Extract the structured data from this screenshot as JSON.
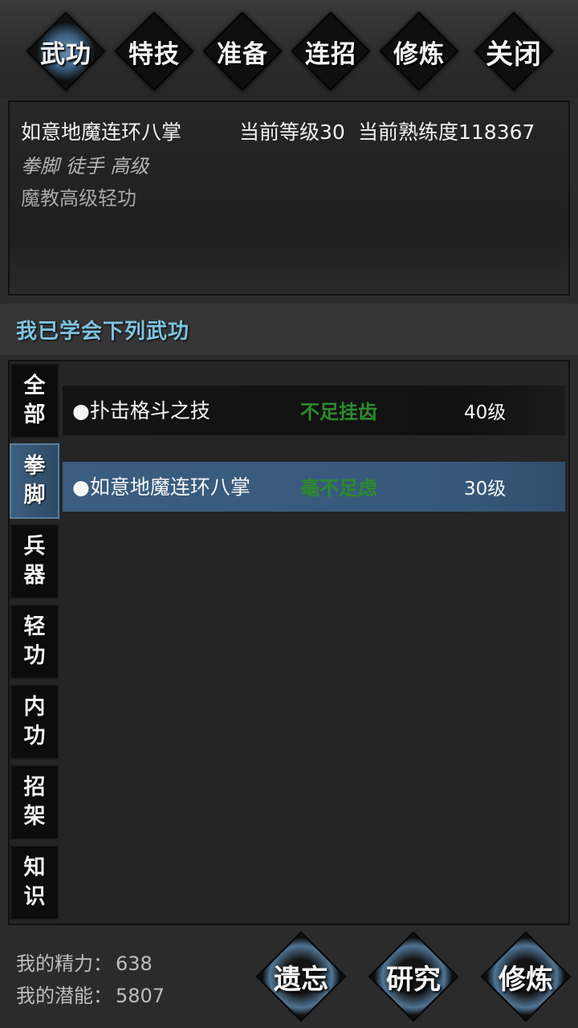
{
  "tabs": [
    {
      "label": "武功"
    },
    {
      "label": "特技"
    },
    {
      "label": "准备"
    },
    {
      "label": "连招"
    },
    {
      "label": "修炼"
    },
    {
      "label": "关闭"
    }
  ],
  "info": {
    "name": "如意地魔连环八掌",
    "level_text": "当前等级30",
    "proficiency_text": "当前熟练度118367",
    "category": "拳脚 徒手 高级",
    "description": "魔教高级轻功"
  },
  "section_title": "我已学会下列武功",
  "side_tabs": [
    {
      "top": "全",
      "bottom": "部"
    },
    {
      "top": "拳",
      "bottom": "脚"
    },
    {
      "top": "兵",
      "bottom": "器"
    },
    {
      "top": "轻",
      "bottom": "功"
    },
    {
      "top": "内",
      "bottom": "功"
    },
    {
      "top": "招",
      "bottom": "架"
    },
    {
      "top": "知",
      "bottom": "识"
    }
  ],
  "skills": [
    {
      "name": "●扑击格斗之技",
      "status": "不足挂齿",
      "level": "40级"
    },
    {
      "name": "●如意地魔连环八掌",
      "status": "毫不足虑",
      "level": "30级"
    }
  ],
  "stats": {
    "energy_label": "我的精力：",
    "energy_value": "638",
    "potential_label": "我的潜能：",
    "potential_value": "5807"
  },
  "actions": {
    "forget": "遗忘",
    "research": "研究",
    "train": "修炼"
  },
  "colors": {
    "accent_blue": "#3a5d80",
    "section_title": "#7fc3e0",
    "status_green": "#2c8a2c"
  }
}
